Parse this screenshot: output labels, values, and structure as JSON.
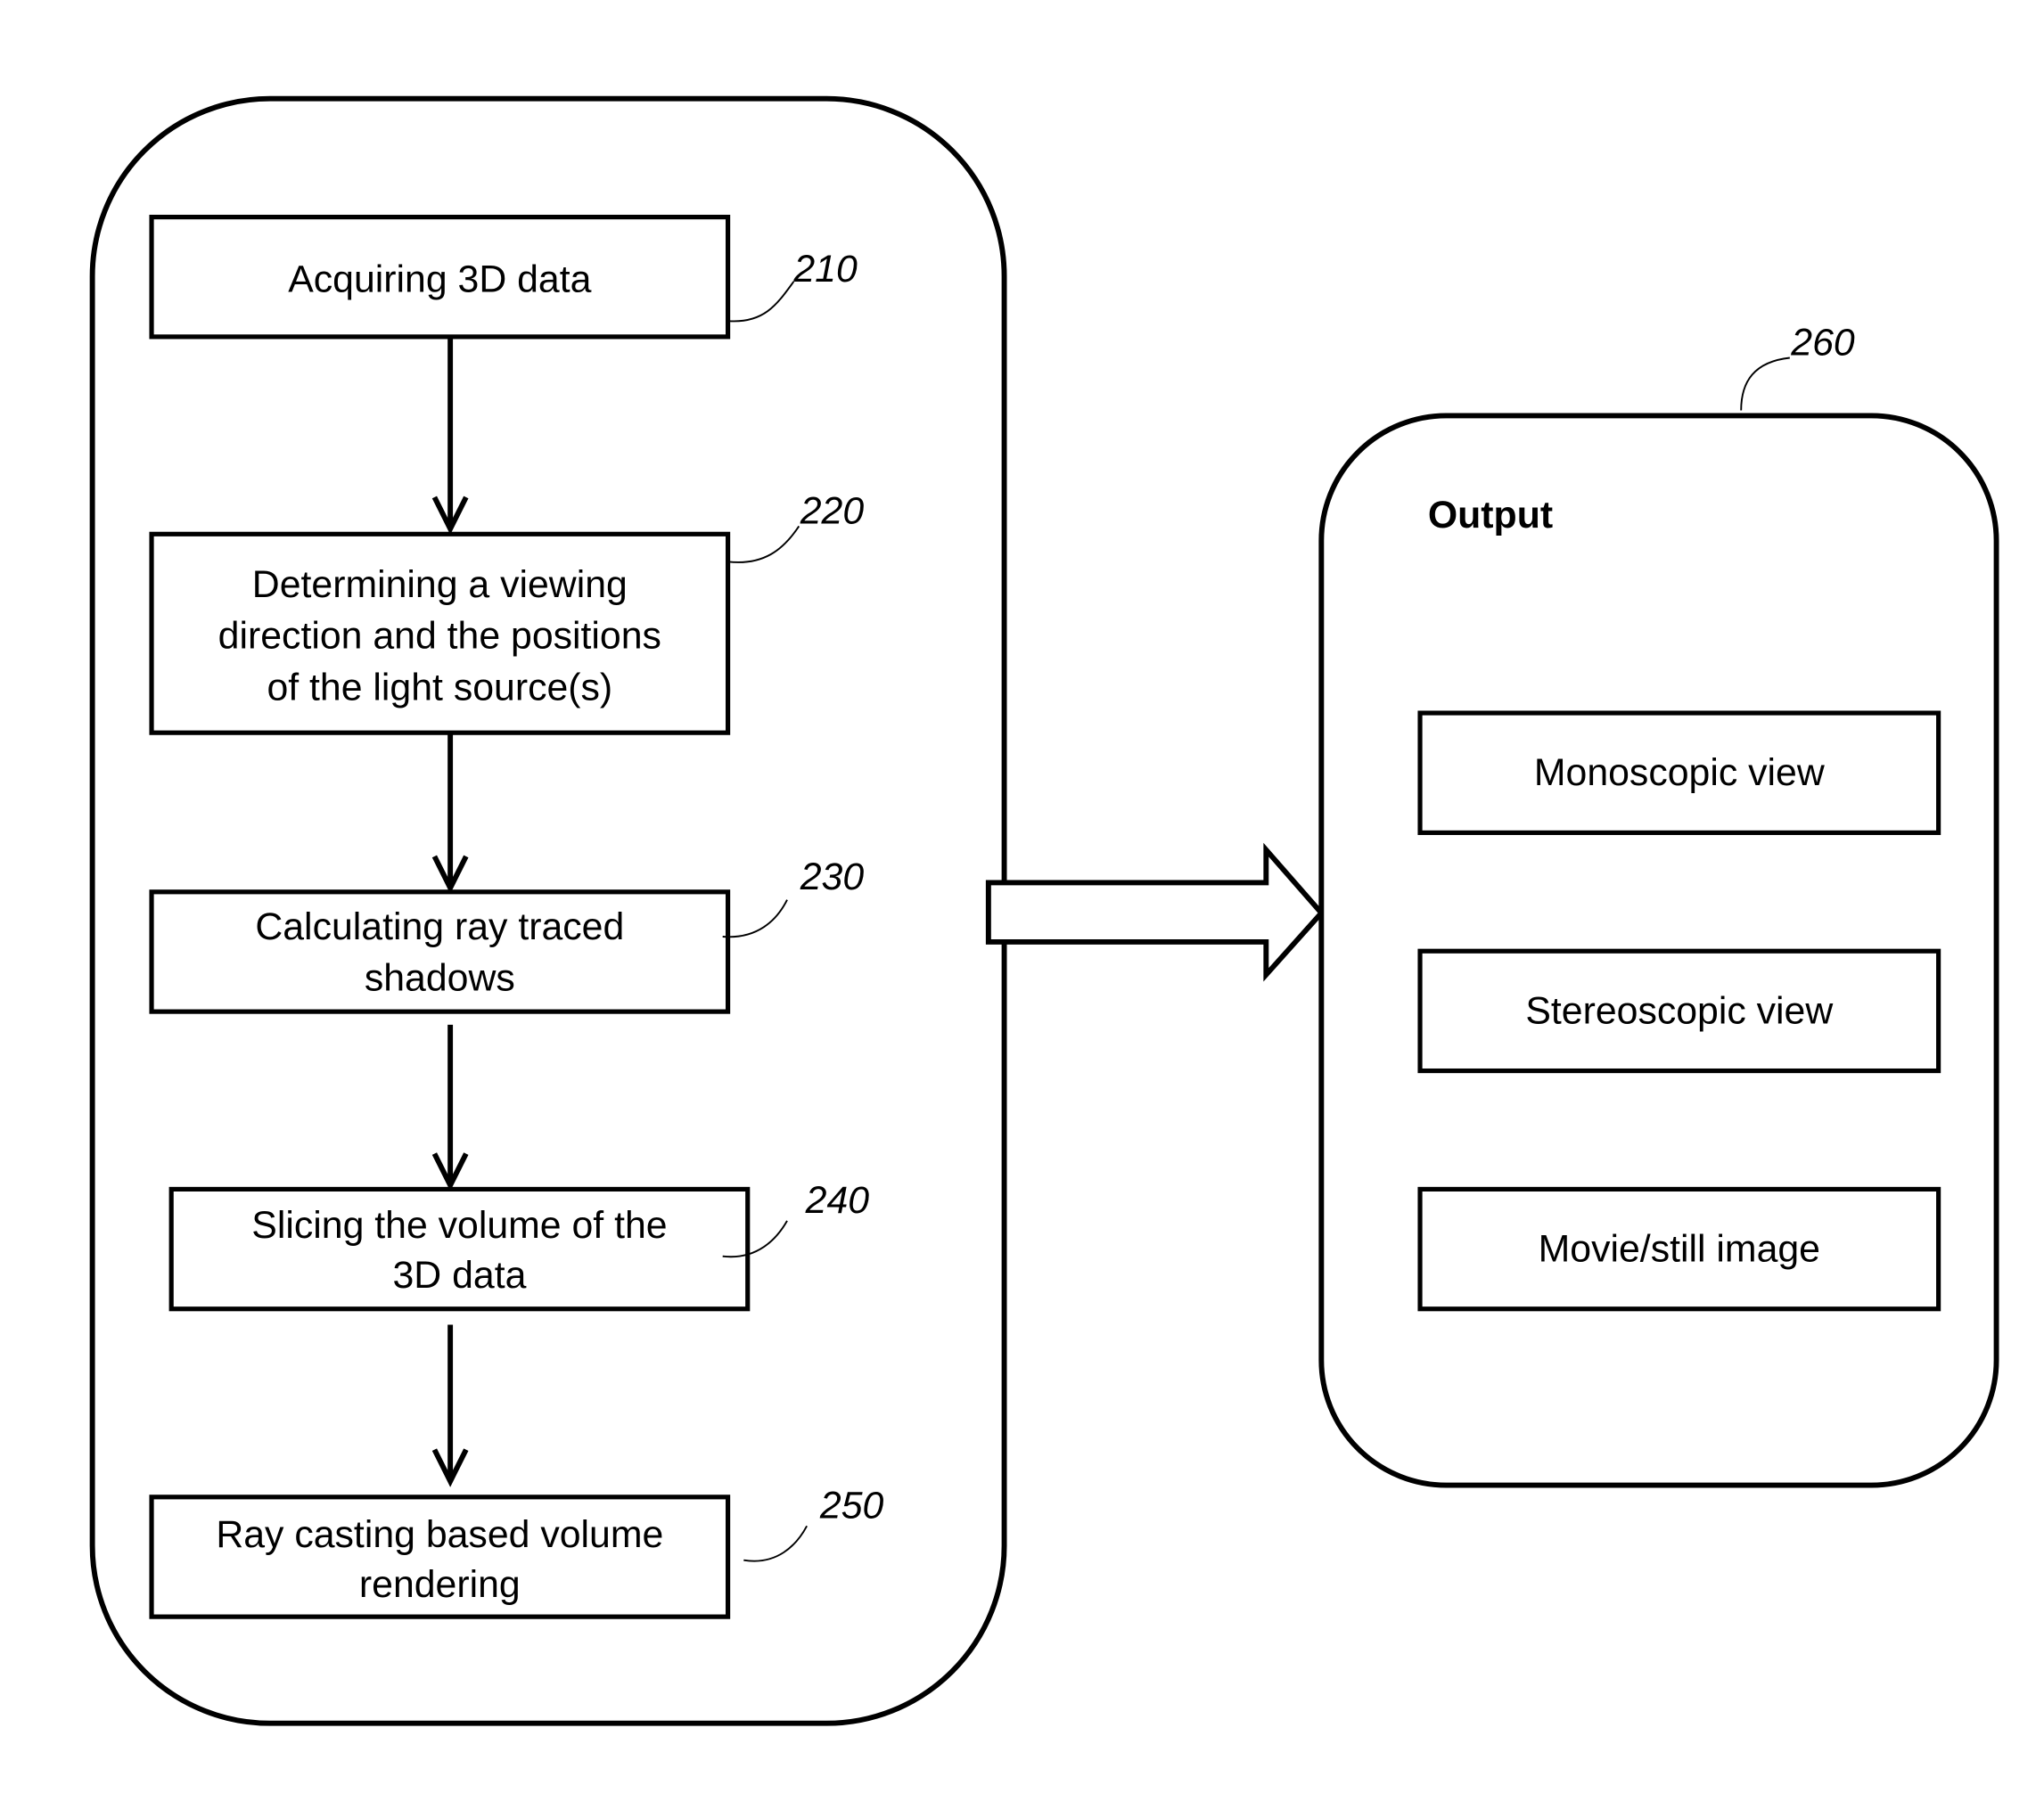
{
  "process": {
    "steps": [
      {
        "id": "210",
        "lines": [
          "Acquiring 3D data"
        ]
      },
      {
        "id": "220",
        "lines": [
          "Determining a viewing",
          "direction and the positions",
          "of the  light source(s)"
        ]
      },
      {
        "id": "230",
        "lines": [
          "Calculating ray traced",
          "shadows"
        ]
      },
      {
        "id": "240",
        "lines": [
          "Slicing the volume of the",
          "3D data"
        ]
      },
      {
        "id": "250",
        "lines": [
          "Ray casting based volume",
          "rendering"
        ]
      }
    ]
  },
  "output": {
    "ref": "260",
    "title": "Output",
    "items": [
      "Monoscopic view",
      "Stereoscopic view",
      "Movie/still image"
    ]
  }
}
